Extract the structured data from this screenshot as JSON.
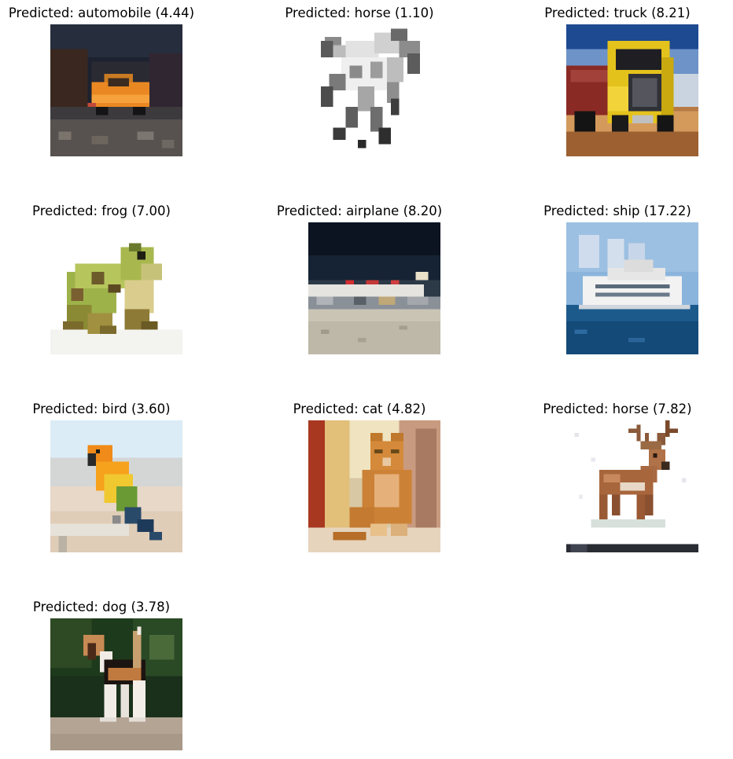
{
  "figure": {
    "panels": [
      {
        "title": "Predicted: automobile (4.44)",
        "subject": "orange car at night",
        "predicted_label": "automobile",
        "score": 4.44
      },
      {
        "title": "Predicted: horse (1.10)",
        "subject": "sketch of running horse",
        "predicted_label": "horse",
        "score": 1.1
      },
      {
        "title": "Predicted: truck (8.21)",
        "subject": "yellow semi truck",
        "predicted_label": "truck",
        "score": 8.21
      },
      {
        "title": "Predicted: frog (7.00)",
        "subject": "green frog",
        "predicted_label": "frog",
        "score": 7.0
      },
      {
        "title": "Predicted: airplane (8.20)",
        "subject": "airport terminal at night",
        "predicted_label": "airplane",
        "score": 8.2
      },
      {
        "title": "Predicted: ship (17.22)",
        "subject": "white cruise ship",
        "predicted_label": "ship",
        "score": 17.22
      },
      {
        "title": "Predicted: bird (3.60)",
        "subject": "orange parrot on perch",
        "predicted_label": "bird",
        "score": 3.6
      },
      {
        "title": "Predicted: cat (4.82)",
        "subject": "orange tabby cat",
        "predicted_label": "cat",
        "score": 4.82
      },
      {
        "title": "Predicted: horse (7.82)",
        "subject": "deer with antlers",
        "predicted_label": "horse",
        "score": 7.82
      },
      {
        "title": "Predicted: dog (3.78)",
        "subject": "beagle dog",
        "predicted_label": "dog",
        "score": 3.78
      }
    ]
  }
}
